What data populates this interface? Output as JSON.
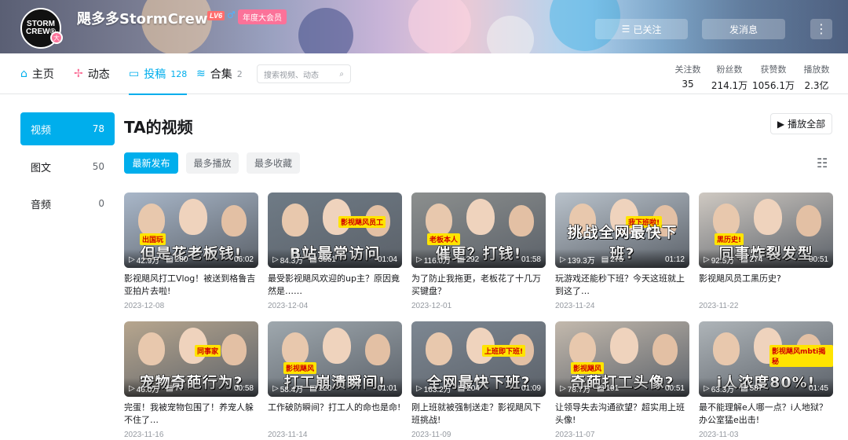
{
  "header": {
    "avatar_text_1": "STORM",
    "avatar_text_2": "CREW®",
    "avatar_badge": "大",
    "username": "飓多多StormCrew",
    "level": "LV6",
    "gender_icon": "♂",
    "vip_badge": "年度大会员",
    "follow_button": "已关注",
    "message_button": "发消息",
    "more_button": "⋮"
  },
  "nav": {
    "tabs": [
      {
        "label": "主页",
        "icon": "home-icon",
        "glyph": "⌂",
        "count": ""
      },
      {
        "label": "动态",
        "icon": "pinwheel-icon",
        "glyph": "✢",
        "count": ""
      },
      {
        "label": "投稿",
        "icon": "tv-icon",
        "glyph": "▭",
        "count": "128"
      },
      {
        "label": "合集",
        "icon": "stack-icon",
        "glyph": "≋",
        "count": "2"
      }
    ],
    "active_tab": "投稿",
    "search_placeholder": "搜索视频、动态",
    "stats": [
      {
        "label": "关注数",
        "value": "35"
      },
      {
        "label": "粉丝数",
        "value": "214.1万"
      },
      {
        "label": "获赞数",
        "value": "1056.1万"
      },
      {
        "label": "播放数",
        "value": "2.3亿"
      }
    ]
  },
  "sidebar": {
    "items": [
      {
        "label": "视频",
        "count": "78"
      },
      {
        "label": "图文",
        "count": "50"
      },
      {
        "label": "音频",
        "count": "0"
      }
    ],
    "active": "视频"
  },
  "main": {
    "title": "TA的视频",
    "play_all": "播放全部",
    "filters": [
      "最新发布",
      "最多播放",
      "最多收藏"
    ],
    "active_filter": "最新发布"
  },
  "videos": [
    {
      "headline": "但是花老板钱!",
      "tag": "出国玩",
      "views": "42.9万",
      "danmaku": "280",
      "duration": "06:02",
      "title": "影视飓风打工Vlog！被送到格鲁吉亚拍片去啦!",
      "date": "2023-12-08",
      "bg": "#a9b7c9"
    },
    {
      "headline": "B站最常访问",
      "tag": "影视飓风员工",
      "views": "84.3万",
      "danmaku": "3661",
      "duration": "01:04",
      "title": "最受影视飓风欢迎的up主？原因竟然是……",
      "date": "2023-12-04",
      "bg": "#6f7b86"
    },
    {
      "headline": "催更？打钱!",
      "tag": "老板本人",
      "views": "116.0万",
      "danmaku": "292",
      "duration": "01:58",
      "title": "为了防止我拖更，老板花了十几万买键盘？",
      "date": "2023-12-01",
      "bg": "#8c8f8e"
    },
    {
      "headline": "挑战全网最快下班?",
      "tag": "我下班啦!",
      "views": "139.3万",
      "danmaku": "275",
      "duration": "01:12",
      "title": "玩游戏还能秒下班？今天这班就上到这了…",
      "date": "2023-11-24",
      "bg": "#b9c2cb"
    },
    {
      "headline": "同事炸裂发型",
      "tag": "黑历史!",
      "views": "92.5万",
      "danmaku": "274",
      "duration": "00:51",
      "title": "影视飓风员工黑历史?",
      "date": "2023-11-22",
      "bg": "#cfc9c2"
    },
    {
      "headline": "宠物奇葩行为?",
      "tag": "同事家",
      "views": "46.0万",
      "danmaku": "77",
      "duration": "00:58",
      "title": "完蛋！我被宠物包围了！养宠人躲不住了…",
      "date": "2023-11-16",
      "bg": "#b7a68e"
    },
    {
      "headline": "打工崩溃瞬间!",
      "tag": "影视飓风",
      "views": "58.4万",
      "danmaku": "120",
      "duration": "01:01",
      "title": "工作破防瞬间？打工人的命也是命!",
      "date": "2023-11-14",
      "bg": "#9fa8ae"
    },
    {
      "headline": "全网最快下班?",
      "tag": "上班即下班!",
      "views": "163.2万",
      "danmaku": "204",
      "duration": "01:09",
      "title": "刚上班就被强制送走？影视飓风下班挑战!",
      "date": "2023-11-09",
      "bg": "#7d8792"
    },
    {
      "headline": "奇葩打工头像?",
      "tag": "影视飓风",
      "views": "78.7万",
      "danmaku": "191",
      "duration": "00:51",
      "title": "让领导失去沟通欲望？超实用上班头像!",
      "date": "2023-11-07",
      "bg": "#c3b9ad"
    },
    {
      "headline": "i人浓度80%!",
      "tag": "影视飓风mbti揭秘",
      "views": "63.3万",
      "danmaku": "587",
      "duration": "01:45",
      "title": "最不能理解e人哪一点？i人地狱？办公室猛e出击!",
      "date": "2023-11-03",
      "bg": "#aeb4b8"
    }
  ]
}
